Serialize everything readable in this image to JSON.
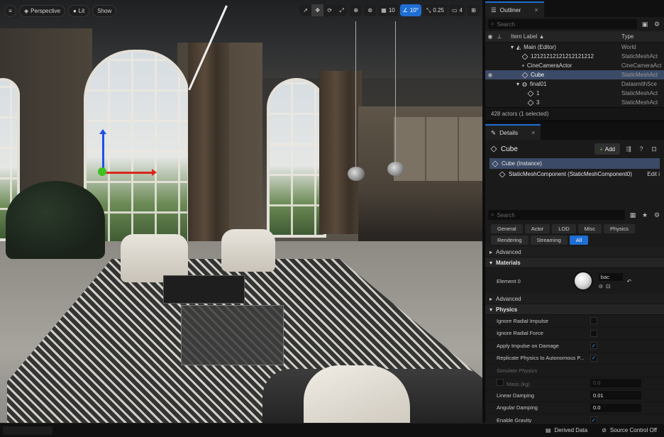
{
  "viewport": {
    "toolbar": {
      "view_mode": "Perspective",
      "lit": "Lit",
      "show": "Show",
      "grid_size": "10",
      "angle_snap": "10°",
      "scale_snap": "0.25",
      "camera_speed": "4"
    }
  },
  "outliner": {
    "tab_label": "Outliner",
    "search_placeholder": "Search",
    "col_label": "Item Label ▲",
    "col_type": "Type",
    "rows": [
      {
        "label": "Main (Editor)",
        "type": "World"
      },
      {
        "label": "12121212121212121212",
        "type": "StaticMeshAct"
      },
      {
        "label": "CineCameraActor",
        "type": "CineCameraAct"
      },
      {
        "label": "Cube",
        "type": "StaticMeshAct"
      },
      {
        "label": "final01",
        "type": "DatasmithSce"
      },
      {
        "label": "1",
        "type": "StaticMeshAct"
      },
      {
        "label": "3",
        "type": "StaticMeshAct"
      }
    ],
    "count": "428 actors (1 selected)"
  },
  "details": {
    "tab_label": "Details",
    "title": "Cube",
    "add_label": "Add",
    "instance_label": "Cube (Instance)",
    "component_label": "StaticMeshComponent (StaticMeshComponent0)",
    "edit_label": "Edit i",
    "search_placeholder": "Search",
    "filter_tabs": [
      "General",
      "Actor",
      "LOD",
      "Misc",
      "Physics",
      "Rendering",
      "Streaming",
      "All"
    ],
    "advanced_label": "Advanced",
    "materials_label": "Materials",
    "element_label": "Element 0",
    "material_value": "bac",
    "physics_label": "Physics",
    "props": [
      {
        "label": "Ignore Radial Impulse",
        "kind": "check",
        "checked": false
      },
      {
        "label": "Ignore Radial Force",
        "kind": "check",
        "checked": false
      },
      {
        "label": "Apply Impulse on Damage",
        "kind": "check",
        "checked": true
      },
      {
        "label": "Replicate Physics to Autonomous P...",
        "kind": "check",
        "checked": true
      },
      {
        "label": "Simulate Physics",
        "kind": "dim"
      },
      {
        "label": "Mass (kg)",
        "kind": "dimnum",
        "value": "0.0"
      },
      {
        "label": "Linear Damping",
        "kind": "num",
        "value": "0.01"
      },
      {
        "label": "Angular Damping",
        "kind": "num",
        "value": "0.0"
      },
      {
        "label": "Enable Gravity",
        "kind": "check",
        "checked": true
      }
    ]
  },
  "statusbar": {
    "derived_data": "Derived Data",
    "source_control": "Source Control Off"
  },
  "colors": {
    "accent": "#1f6ed4",
    "selection": "#3b4a66",
    "panel": "#1a1a1a"
  }
}
